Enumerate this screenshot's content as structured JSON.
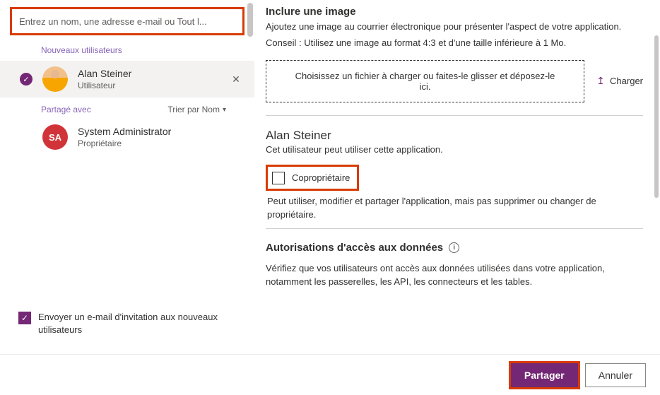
{
  "search": {
    "placeholder": "Entrez un nom, une adresse e-mail ou Tout l..."
  },
  "labels": {
    "new_users": "Nouveaux utilisateurs",
    "shared_with": "Partagé avec",
    "sort_by_name": "Trier par Nom"
  },
  "users": {
    "alan": {
      "name": "Alan Steiner",
      "role": "Utilisateur"
    },
    "sa": {
      "name": "System Administrator",
      "role": "Propriétaire",
      "initials": "SA"
    }
  },
  "invite": {
    "label": "Envoyer un e-mail d'invitation aux nouveaux utilisateurs"
  },
  "image_section": {
    "heading": "Inclure une image",
    "desc": "Ajoutez une image au courrier électronique pour présenter l'aspect de votre application.",
    "tip": "Conseil : Utilisez une image au format 4:3 et d'une taille inférieure à 1 Mo.",
    "dropzone": "Choisissez un fichier à charger ou faites-le glisser et déposez-le ici.",
    "upload_label": "Charger"
  },
  "user_detail": {
    "name": "Alan Steiner",
    "desc": "Cet utilisateur peut utiliser cette application.",
    "coowner_label": "Copropriétaire",
    "coowner_desc": "Peut utiliser, modifier et partager l'application, mais pas supprimer ou changer de propriétaire."
  },
  "permissions": {
    "heading": "Autorisations d'accès aux données",
    "desc": "Vérifiez que vos utilisateurs ont accès aux données utilisées dans votre application, notamment les passerelles, les API, les connecteurs et les tables."
  },
  "footer": {
    "share": "Partager",
    "cancel": "Annuler"
  }
}
